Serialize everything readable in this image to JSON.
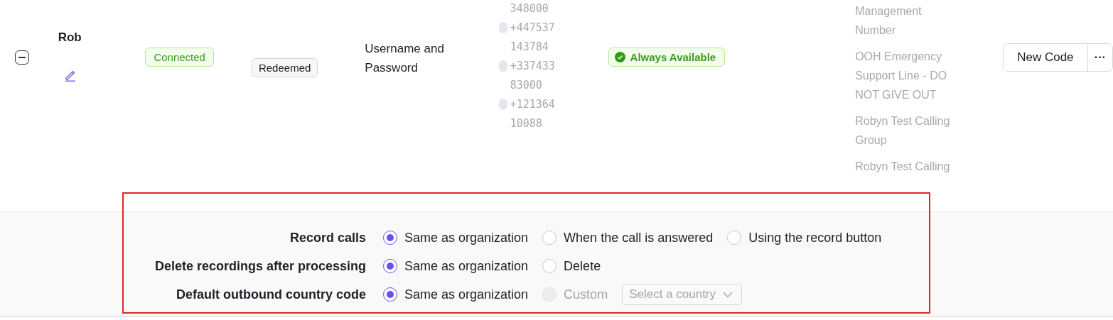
{
  "row": {
    "expanded": true,
    "name": "Rob",
    "status": "Connected",
    "code_status": "Redeemed",
    "auth_method": "Username and Password",
    "numbers": [
      {
        "kind": "plain",
        "text": "348000"
      },
      {
        "kind": "phone",
        "text": "+447537"
      },
      {
        "kind": "plain",
        "text": "143784"
      },
      {
        "kind": "phone",
        "text": "+337433"
      },
      {
        "kind": "plain",
        "text": "83000"
      },
      {
        "kind": "phone",
        "text": "+121364"
      },
      {
        "kind": "plain",
        "text": "10088"
      }
    ],
    "availability": "Always Available",
    "groups": [
      {
        "lines": [
          "Management",
          "Number"
        ]
      },
      {
        "lines": [
          "OOH Emergency",
          "Support Line - DO",
          "NOT GIVE OUT"
        ]
      },
      {
        "lines": [
          "Robyn Test Calling",
          "Group"
        ]
      },
      {
        "lines": [
          "Robyn Test Calling"
        ]
      }
    ],
    "actions": {
      "primary": "New Code",
      "more": "···"
    }
  },
  "settings": [
    {
      "label": "Record calls",
      "options": [
        {
          "label": "Same as organization",
          "selected": true,
          "disabled": false
        },
        {
          "label": "When the call is answered",
          "selected": false,
          "disabled": false
        },
        {
          "label": "Using the record button",
          "selected": false,
          "disabled": false
        }
      ]
    },
    {
      "label": "Delete recordings after processing",
      "options": [
        {
          "label": "Same as organization",
          "selected": true,
          "disabled": false
        },
        {
          "label": "Delete",
          "selected": false,
          "disabled": false
        }
      ]
    },
    {
      "label": "Default outbound country code",
      "options": [
        {
          "label": "Same as organization",
          "selected": true,
          "disabled": false
        },
        {
          "label": "Custom",
          "selected": false,
          "disabled": true
        }
      ],
      "select": {
        "placeholder": "Select a country",
        "disabled": true
      }
    }
  ]
}
